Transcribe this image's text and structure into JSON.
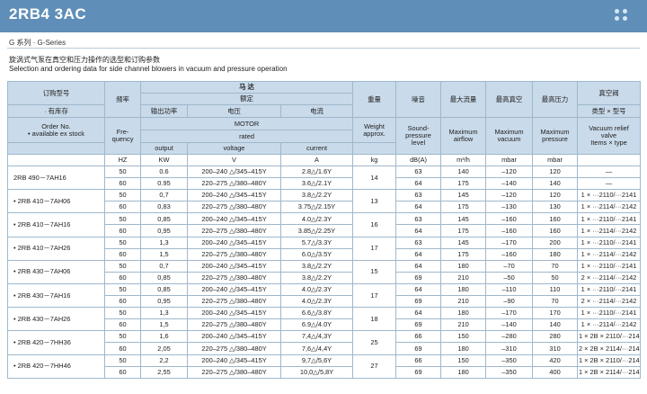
{
  "header": {
    "title": "2RB4 3AC",
    "series": "G 系列 · G-Series",
    "description_cn": "旋涡式气泵在真空和压力操作的选型和订购参数",
    "description_en": "Selection and ordering data for side channel blowers in vacuum and pressure operation",
    "accent_color": "#5f8fb8"
  },
  "table": {
    "head_cn": {
      "order_no": "订购型号",
      "stock": "· 有库存",
      "frequency": "频率",
      "motor": "马    达",
      "rated": "额定",
      "output": "输出功率",
      "voltage": "电压",
      "current": "电流",
      "weight": "重量",
      "noise": "噪音",
      "max_airflow": "最大流量",
      "max_vacuum": "最高真空",
      "max_pressure": "最高压力",
      "relief_valve": "真空阀",
      "relief_type": "类型 × 型号"
    },
    "head_en": {
      "order_no": "Order No.",
      "stock": "• available ex stock",
      "frequency_1": "Fre-",
      "frequency_2": "quency",
      "motor": "MOTOR",
      "rated": "rated",
      "output": "output",
      "voltage": "voltage",
      "current": "current",
      "weight_1": "Weight",
      "weight_2": "approx.",
      "noise_1": "Sound-",
      "noise_2": "pressure",
      "noise_3": "level",
      "max_airflow_1": "Maximum",
      "max_airflow_2": "airflow",
      "max_vacuum_1": "Maximum",
      "max_vacuum_2": "vacuum",
      "max_pressure_1": "Maximum",
      "max_pressure_2": "pressure",
      "relief_1": "Vacuum relief",
      "relief_2": "valve",
      "relief_3": "Items × type"
    },
    "units": {
      "frequency": "HZ",
      "output": "KW",
      "voltage": "V",
      "current": "A",
      "weight": "kg",
      "noise": "dB(A)",
      "airflow": "m³/h",
      "vacuum": "mbar",
      "pressure": "mbar"
    },
    "models": [
      {
        "order": "2RB 490－7AH16",
        "weight": "14",
        "rows": [
          {
            "hz": "50",
            "kw": "0.6",
            "v": "200–240 △/345–415Y",
            "a": "2.8△/1.6Y",
            "db": "63",
            "flow": "140",
            "vac": "–120",
            "pres": "120",
            "valve": "—"
          },
          {
            "hz": "60",
            "kw": "0.95",
            "v": "220–275 △/380–480Y",
            "a": "3.6△/2.1Y",
            "db": "64",
            "flow": "175",
            "vac": "–140",
            "pres": "140",
            "valve": "—"
          }
        ]
      },
      {
        "order": "• 2RB 410－7AH06",
        "weight": "13",
        "rows": [
          {
            "hz": "50",
            "kw": "0,7",
            "v": "200–240 △/345–415Y",
            "a": "3.8△/2.2Y",
            "db": "63",
            "flow": "145",
            "vac": "–120",
            "pres": "120",
            "valve": "1 × ···2110/···2141"
          },
          {
            "hz": "60",
            "kw": "0,83",
            "v": "220–275 △/380–480Y",
            "a": "3.75△/2.15Y",
            "db": "64",
            "flow": "175",
            "vac": "–130",
            "pres": "130",
            "valve": "1 × ···2114/···2142"
          }
        ]
      },
      {
        "order": "• 2RB 410－7AH16",
        "weight": "16",
        "rows": [
          {
            "hz": "50",
            "kw": "0,85",
            "v": "200–240 △/345–415Y",
            "a": "4.0△/2.3Y",
            "db": "63",
            "flow": "145",
            "vac": "–160",
            "pres": "160",
            "valve": "1 × ···2110/···2141"
          },
          {
            "hz": "60",
            "kw": "0,95",
            "v": "220–275 △/380–480Y",
            "a": "3.85△/2.25Y",
            "db": "64",
            "flow": "175",
            "vac": "–160",
            "pres": "160",
            "valve": "1 × ···2114/···2142"
          }
        ]
      },
      {
        "order": "• 2RB 410－7AH26",
        "weight": "17",
        "rows": [
          {
            "hz": "50",
            "kw": "1,3",
            "v": "200–240 △/345–415Y",
            "a": "5.7△/3.3Y",
            "db": "63",
            "flow": "145",
            "vac": "–170",
            "pres": "200",
            "valve": "1 × ···2110/···2141"
          },
          {
            "hz": "60",
            "kw": "1,5",
            "v": "220–275 △/380–480Y",
            "a": "6.0△/3.5Y",
            "db": "64",
            "flow": "175",
            "vac": "–160",
            "pres": "180",
            "valve": "1 × ···2114/···2142"
          }
        ]
      },
      {
        "order": "• 2RB 430－7AH06",
        "weight": "15",
        "rows": [
          {
            "hz": "50",
            "kw": "0,7",
            "v": "200–240 △/345–415Y",
            "a": "3.8△/2.2Y",
            "db": "64",
            "flow": "180",
            "vac": "–70",
            "pres": "70",
            "valve": "1 × ···2110/···2141"
          },
          {
            "hz": "60",
            "kw": "0,85",
            "v": "220–275 △/380–480Y",
            "a": "3.8△/2.2Y",
            "db": "69",
            "flow": "210",
            "vac": "–50",
            "pres": "50",
            "valve": "2 × ···2114/···2142"
          }
        ]
      },
      {
        "order": "• 2RB 430－7AH16",
        "weight": "17",
        "rows": [
          {
            "hz": "50",
            "kw": "0,85",
            "v": "200–240 △/345–415Y",
            "a": "4.0△/2.3Y",
            "db": "64",
            "flow": "180",
            "vac": "–110",
            "pres": "110",
            "valve": "1 × ···2110/···2141"
          },
          {
            "hz": "60",
            "kw": "0,95",
            "v": "220–275 △/380–480Y",
            "a": "4.0△/2.3Y",
            "db": "69",
            "flow": "210",
            "vac": "–90",
            "pres": "70",
            "valve": "2 × ···2114/···2142"
          }
        ]
      },
      {
        "order": "• 2RB 430－7AH26",
        "weight": "18",
        "rows": [
          {
            "hz": "50",
            "kw": "1,3",
            "v": "200–240 △/345–415Y",
            "a": "6.6△/3.8Y",
            "db": "64",
            "flow": "180",
            "vac": "–170",
            "pres": "170",
            "valve": "1 × ···2110/···2141"
          },
          {
            "hz": "60",
            "kw": "1,5",
            "v": "220–275 △/380–480Y",
            "a": "6.9△/4.0Y",
            "db": "69",
            "flow": "210",
            "vac": "–140",
            "pres": "140",
            "valve": "1 × ···2114/···2142"
          }
        ]
      },
      {
        "order": "• 2RB 420－7HH36",
        "weight": "25",
        "rows": [
          {
            "hz": "50",
            "kw": "1,6",
            "v": "200–240 △/345–415Y",
            "a": "7,4△/4,3Y",
            "db": "66",
            "flow": "150",
            "vac": "–280",
            "pres": "280",
            "valve": "1 × 2B × 2110/···2141"
          },
          {
            "hz": "60",
            "kw": "2,05",
            "v": "220–275 △/380–480Y",
            "a": "7,6△/4,4Y",
            "db": "69",
            "flow": "180",
            "vac": "–310",
            "pres": "310",
            "valve": "2 × 2B × 2114/···2142"
          }
        ]
      },
      {
        "order": "• 2RB 420－7HH46",
        "weight": "27",
        "rows": [
          {
            "hz": "50",
            "kw": "2,2",
            "v": "200–240 △/345–415Y",
            "a": "9,7△/5,6Y",
            "db": "66",
            "flow": "150",
            "vac": "–350",
            "pres": "420",
            "valve": "1 × 2B × 2110/···2141"
          },
          {
            "hz": "60",
            "kw": "2,55",
            "v": "220–275 △/380–480Y",
            "a": "10,0△/5,8Y",
            "db": "69",
            "flow": "180",
            "vac": "–350",
            "pres": "400",
            "valve": "1 × 2B × 2114/···2142"
          }
        ]
      }
    ]
  }
}
